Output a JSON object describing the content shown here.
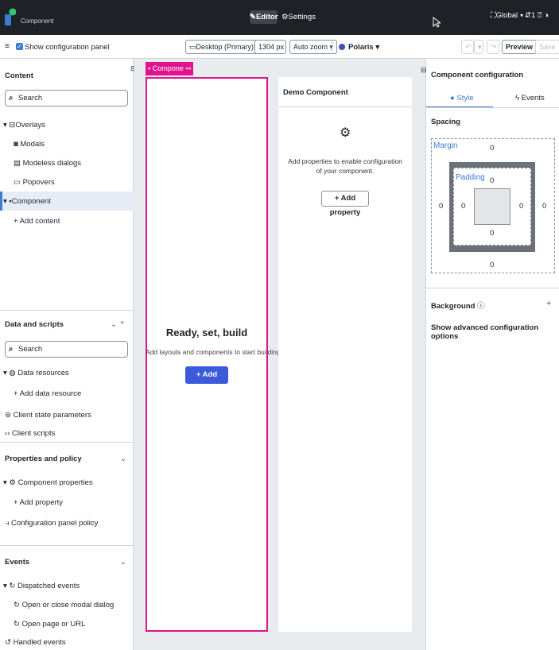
{
  "header": {
    "title": "Demo Component",
    "subtitle": "Component",
    "tab_editor": "Editor",
    "tab_settings": "Settings",
    "global": "Global",
    "misc": "⇵1  ⍰  ◑"
  },
  "toolbar": {
    "show_config": "Show configuration panel",
    "device": "Desktop (Primary)*",
    "width": "1304",
    "unit": "px",
    "zoom": "Auto zoom",
    "theme": "Polaris",
    "preview": "Preview",
    "save": "Save"
  },
  "content": {
    "title": "Content",
    "search_placeholder": "Search",
    "overlays": "Overlays",
    "modals": "Modals",
    "modeless": "Modeless dialogs",
    "popovers": "Popovers",
    "component": "Component",
    "add_content": "+ Add content"
  },
  "data_scripts": {
    "title": "Data and scripts",
    "search_placeholder": "Search",
    "resources": "Data resources",
    "add_resource": "+ Add data resource",
    "client_state": "Client state parameters",
    "client_scripts": "Client scripts"
  },
  "props": {
    "title": "Properties and policy",
    "component_props": "Component properties",
    "add_property": "+ Add property",
    "policy": "Configuration panel policy"
  },
  "events": {
    "title": "Events",
    "dispatched": "Dispatched events",
    "open_close": "Open or close modal dialog",
    "open_page": "Open page or URL",
    "handled": "Handled events"
  },
  "canvas": {
    "tag": "Component",
    "ready_title": "Ready, set, build",
    "ready_sub": "Add layouts and components to start building",
    "add_content": "+ Add content"
  },
  "preview": {
    "title": "Demo Component",
    "message": "Add properties to enable configuration of your component.",
    "add_property": "+ Add property"
  },
  "config": {
    "title": "Component configuration",
    "tab_style": "Style",
    "tab_events": "Events",
    "spacing": "Spacing",
    "margin": "Margin",
    "padding": "Padding",
    "margin_top": "0",
    "margin_left": "0",
    "margin_right": "0",
    "margin_bottom": "0",
    "padding_top": "0",
    "padding_left": "0",
    "padding_right": "0",
    "padding_bottom": "0",
    "background": "Background",
    "advanced": "Show advanced configuration options"
  },
  "colors": {
    "accent": "#3a7bd5",
    "selection": "#e0138c",
    "topbar": "#1e2125"
  }
}
